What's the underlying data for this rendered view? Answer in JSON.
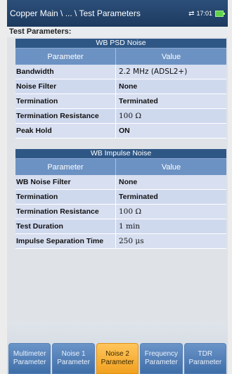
{
  "header": {
    "breadcrumb": "Copper Main \\ ... \\ Test Parameters",
    "time": "17:01",
    "status_icons": [
      "network-icon",
      "battery-icon"
    ]
  },
  "page": {
    "section_title": "Test Parameters:"
  },
  "wb_psd_noise": {
    "title": "WB PSD Noise",
    "columns": [
      "Parameter",
      "Value"
    ],
    "rows": [
      {
        "parameter": "Bandwidth",
        "value": "2.2 MHz (ADSL2+)"
      },
      {
        "parameter": "Noise Filter",
        "value": "None"
      },
      {
        "parameter": "Termination",
        "value": "Terminated"
      },
      {
        "parameter": "Termination Resistance",
        "value": "100 Ω"
      },
      {
        "parameter": "Peak Hold",
        "value": "ON"
      }
    ]
  },
  "wb_impulse_noise": {
    "title": "WB Impulse Noise",
    "columns": [
      "Parameter",
      "Value"
    ],
    "rows": [
      {
        "parameter": "WB Noise Filter",
        "value": "None"
      },
      {
        "parameter": "Termination",
        "value": "Terminated"
      },
      {
        "parameter": "Termination Resistance",
        "value": "100 Ω"
      },
      {
        "parameter": "Test Duration",
        "value": "1 min"
      },
      {
        "parameter": "Impulse Separation Time",
        "value": "250 μs"
      }
    ]
  },
  "tabs": [
    {
      "line1": "Multimeter",
      "line2": "Parameter",
      "active": false
    },
    {
      "line1": "Noise 1",
      "line2": "Parameter",
      "active": false
    },
    {
      "line1": "Noise 2",
      "line2": "Parameter",
      "active": true
    },
    {
      "line1": "Frequency",
      "line2": "Parameter",
      "active": false
    },
    {
      "line1": "TDR",
      "line2": "Parameter",
      "active": false
    }
  ],
  "colors": {
    "header_bg": "#1d3a5f",
    "group_head_bg": "#2f5785",
    "column_head_bg": "#6c92c3",
    "row_bg": "#d7dff0",
    "tab_bg": "#3f6ea8",
    "tab_active_bg": "#f1a11f"
  }
}
